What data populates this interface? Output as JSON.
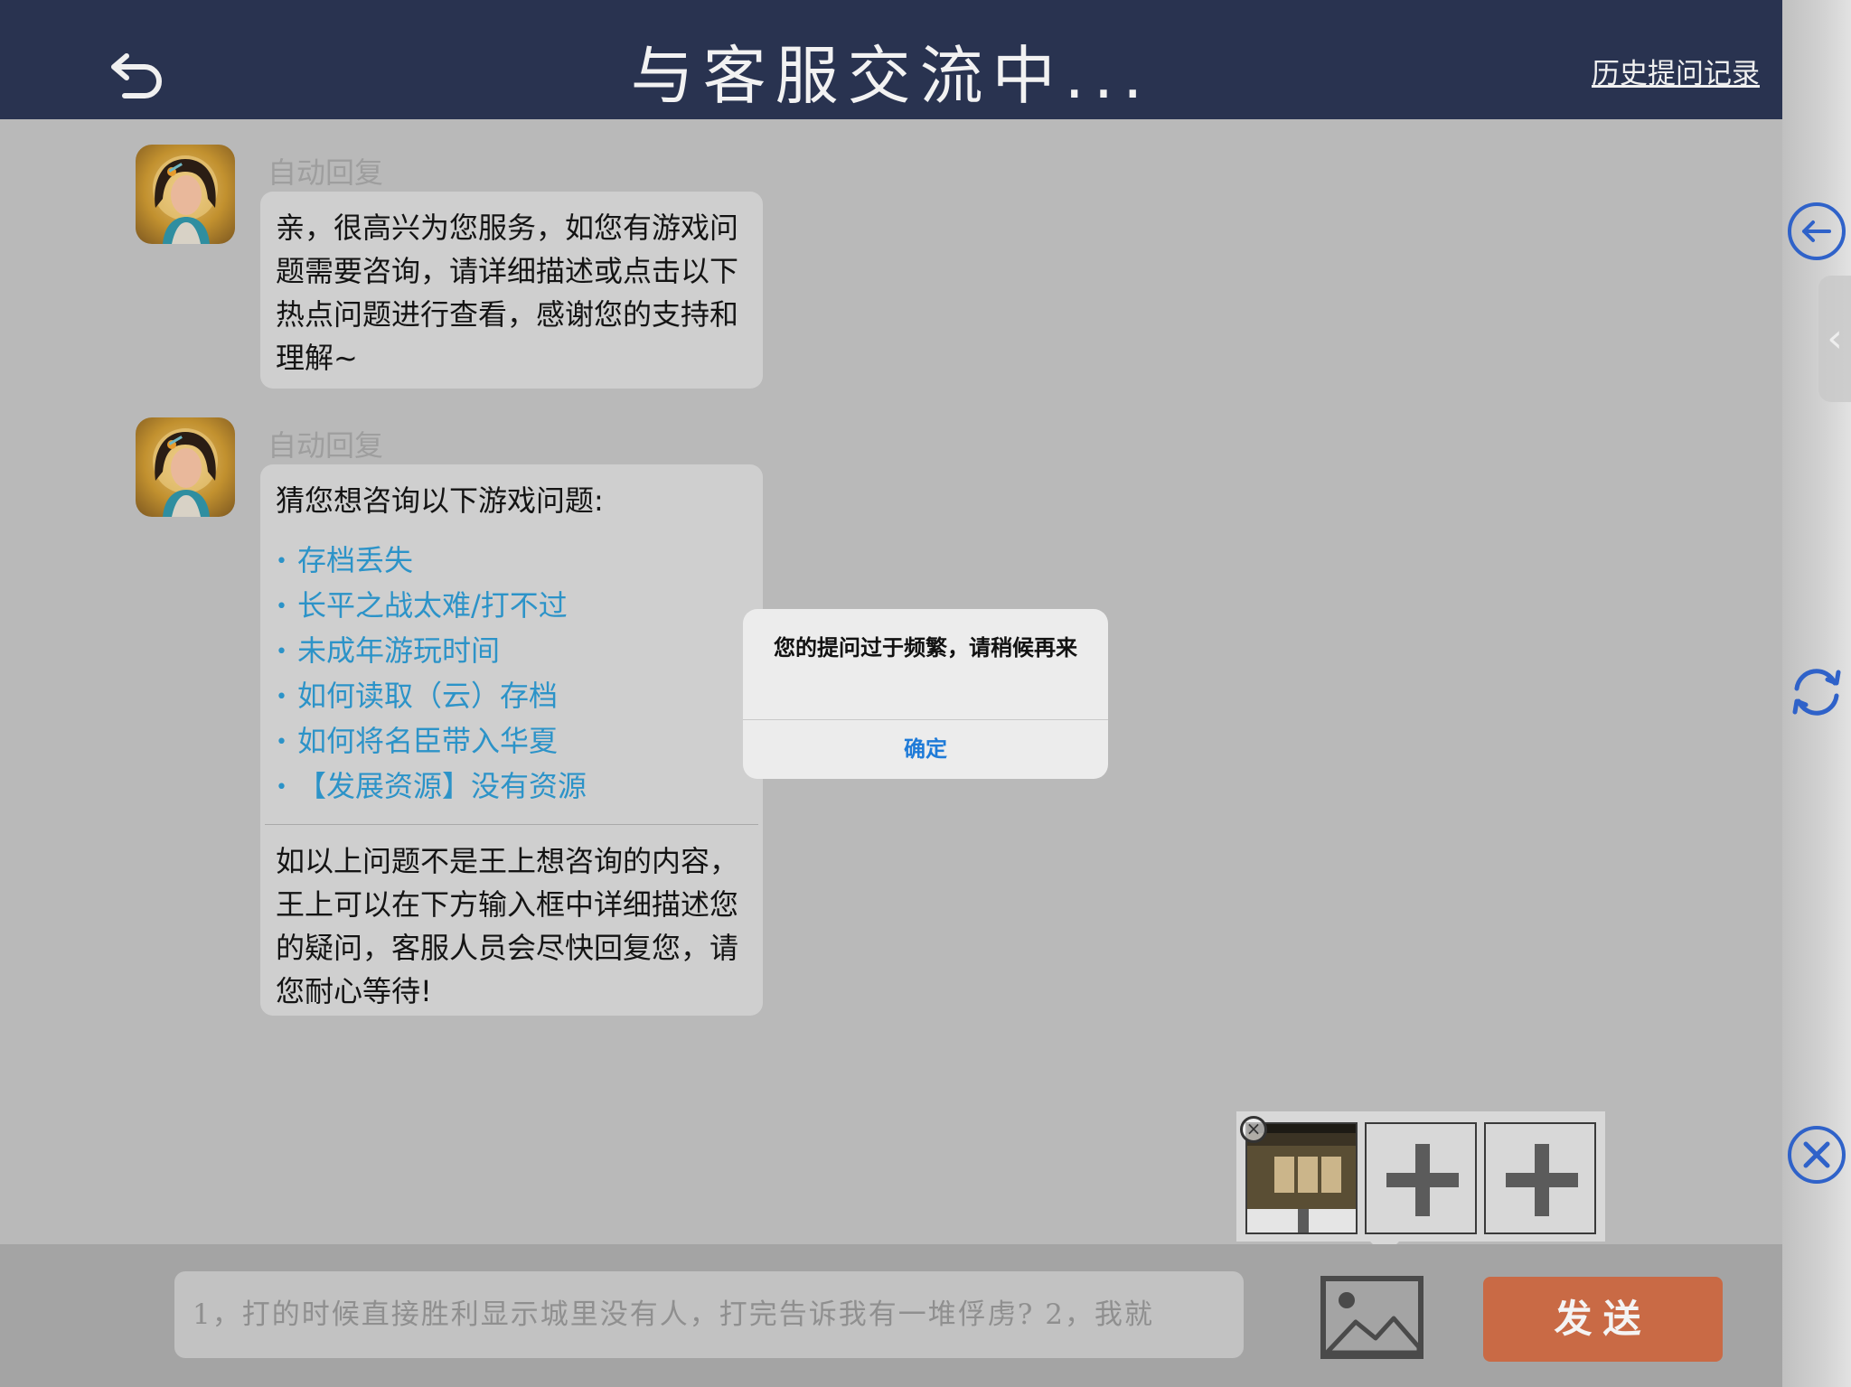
{
  "header": {
    "title": "与客服交流中...",
    "history_link": "历史提问记录",
    "back_icon": "undo-arrow-icon"
  },
  "messages": [
    {
      "sender": "自动回复",
      "text": "亲，很高兴为您服务，如您有游戏问题需要咨询，请详细描述或点击以下热点问题进行查看，感谢您的支持和理解~"
    },
    {
      "sender": "自动回复",
      "intro": "猜您想咨询以下游戏问题:",
      "faq": [
        "存档丢失",
        "长平之战太难/打不过",
        "未成年游玩时间",
        "如何读取（云）存档",
        "如何将名臣带入华夏",
        "【发展资源】没有资源"
      ],
      "footer": "如以上问题不是王上想咨询的内容，王上可以在下方输入框中详细描述您的疑问，客服人员会尽快回复您，请您耐心等待!"
    }
  ],
  "dialog": {
    "message": "您的提问过于频繁，请稍候再来",
    "confirm_label": "确定"
  },
  "composer": {
    "input_value": "1，打的时候直接胜利显示城里没有人，打完告诉我有一堆俘虏? 2，我就",
    "send_label": "发送",
    "image_icon": "image-icon"
  },
  "sidebar": {
    "back_icon": "circle-arrow-left-icon",
    "refresh_icon": "refresh-icon",
    "close_icon": "circle-close-icon",
    "collapse_label": "‹"
  },
  "colors": {
    "header_bg": "#293350",
    "faq_link": "#2c93c8",
    "send_button": "#c96a45",
    "side_icons": "#2f62c9"
  }
}
